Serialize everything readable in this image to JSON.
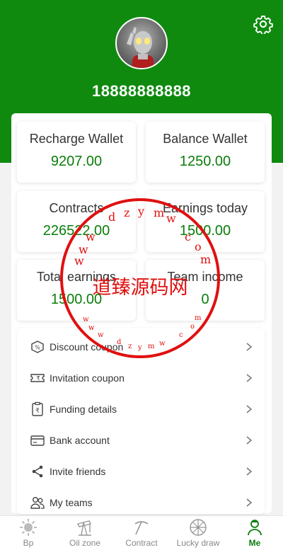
{
  "header": {
    "phone": "18888888888",
    "settings_icon": "gear-icon",
    "avatar_icon": "avatar"
  },
  "cards": [
    {
      "title": "Recharge Wallet",
      "value": "9207.00"
    },
    {
      "title": "Balance Wallet",
      "value": "1250.00"
    },
    {
      "title": "Contracts",
      "value": "226522.00"
    },
    {
      "title": "Earnings today",
      "value": "1500.00"
    },
    {
      "title": "Total earnings",
      "value": "1500.00"
    },
    {
      "title": "Team income",
      "value": "0"
    }
  ],
  "menu": [
    {
      "label": "Discount coupon",
      "icon": "discount-coupon-icon"
    },
    {
      "label": "Invitation coupon",
      "icon": "ticket-icon"
    },
    {
      "label": "Funding details",
      "icon": "rupee-document-icon"
    },
    {
      "label": "Bank account",
      "icon": "bank-card-icon"
    },
    {
      "label": "Invite friends",
      "icon": "share-icon"
    },
    {
      "label": "My teams",
      "icon": "team-icon"
    }
  ],
  "tabs": [
    {
      "label": "Bp",
      "icon": "sun-icon"
    },
    {
      "label": "Oil zone",
      "icon": "oil-pump-icon"
    },
    {
      "label": "Contract",
      "icon": "pickaxe-icon"
    },
    {
      "label": "Lucky draw",
      "icon": "wheel-icon"
    },
    {
      "label": "Me",
      "icon": "person-icon"
    }
  ],
  "watermark": {
    "center_text": "道臻源码网",
    "ring_text": "www.dzymw.com",
    "color": "#e01010"
  },
  "colors": {
    "brand": "#0f8a0f",
    "value": "#0a7d0a"
  }
}
